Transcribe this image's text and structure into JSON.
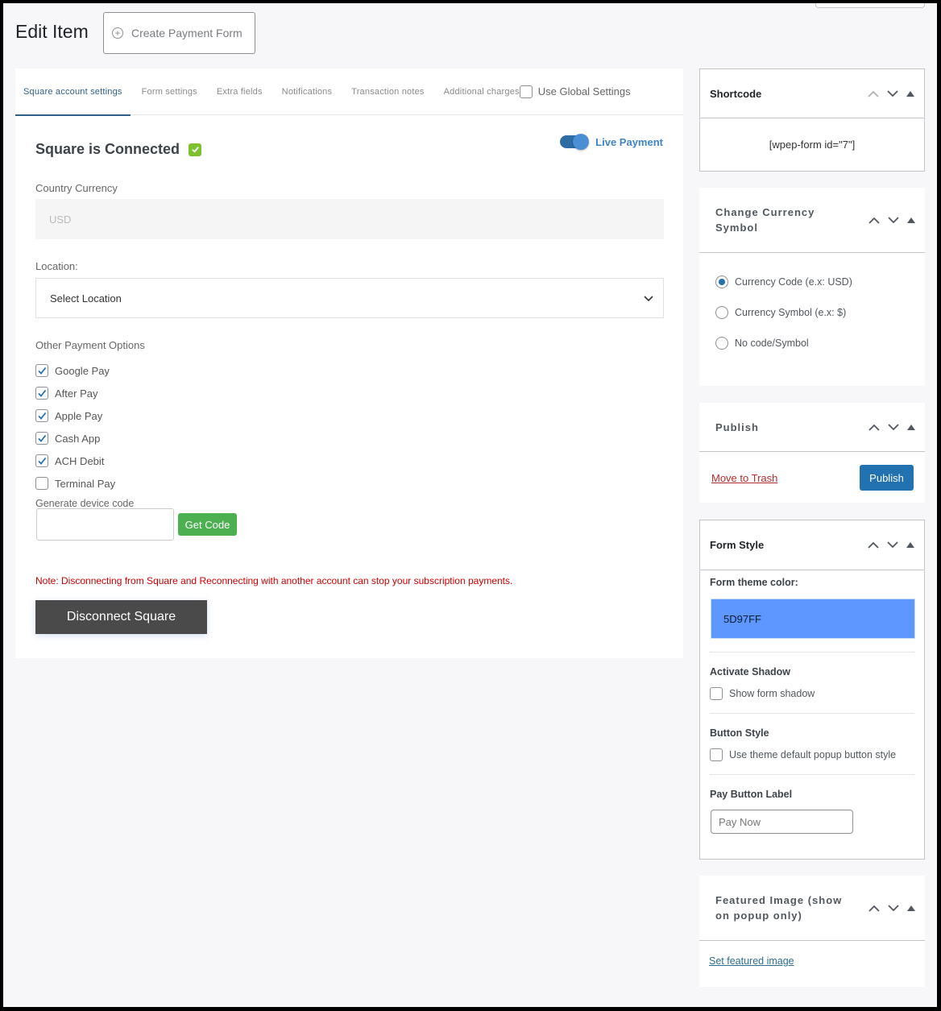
{
  "header": {
    "title": "Edit Item",
    "create_button": "Create Payment Form"
  },
  "tabs": [
    {
      "label": "Square account settings",
      "active": true
    },
    {
      "label": "Form settings",
      "active": false
    },
    {
      "label": "Extra fields",
      "active": false
    },
    {
      "label": "Notifications",
      "active": false
    },
    {
      "label": "Transaction notes",
      "active": false
    },
    {
      "label": "Additional charges",
      "active": false
    }
  ],
  "global_settings": {
    "label": "Use Global Settings",
    "checked": false
  },
  "square": {
    "status": "Square is Connected",
    "live_payment_label": "Live Payment",
    "live_payment_on": true,
    "currency_label": "Country Currency",
    "currency_value": "USD",
    "location_label": "Location:",
    "location_selected": "Select Location",
    "other_options_label": "Other Payment Options",
    "payment_options": [
      {
        "label": "Google Pay",
        "checked": true
      },
      {
        "label": "After Pay",
        "checked": true
      },
      {
        "label": "Apple Pay",
        "checked": true
      },
      {
        "label": "Cash App",
        "checked": true
      },
      {
        "label": "ACH Debit",
        "checked": true
      },
      {
        "label": "Terminal Pay",
        "checked": false
      }
    ],
    "device_code_label": "Generate device code",
    "device_code_value": "",
    "get_code_button": "Get Code",
    "note": "Note: Disconnecting from Square and Reconnecting with another account can stop your subscription payments.",
    "disconnect_button": "Disconnect Square"
  },
  "sidebar": {
    "shortcode": {
      "title": "Shortcode",
      "value": "[wpep-form id=\"7\"]"
    },
    "currency_symbol": {
      "title": "Change Currency Symbol",
      "options": [
        {
          "label": "Currency Code (e.x: USD)",
          "selected": true
        },
        {
          "label": "Currency Symbol (e.x: $)",
          "selected": false
        },
        {
          "label": "No code/Symbol",
          "selected": false
        }
      ]
    },
    "publish": {
      "title": "Publish",
      "trash_label": "Move to Trash",
      "publish_button": "Publish"
    },
    "form_style": {
      "title": "Form Style",
      "theme_color_label": "Form theme color:",
      "theme_color_value": "5D97FF",
      "theme_color_hex": "#5d97ff",
      "shadow_label": "Activate Shadow",
      "shadow_option": "Show form shadow",
      "shadow_checked": false,
      "button_style_label": "Button Style",
      "button_style_option": "Use theme default popup button style",
      "button_style_checked": false,
      "pay_label": "Pay Button Label",
      "pay_value": "Pay Now"
    },
    "featured_image": {
      "title": "Featured Image (show on popup only)",
      "link": "Set featured image"
    }
  },
  "colors": {
    "accent": "#2271b1",
    "tab_active": "#2e5f8a",
    "success": "#4caf50",
    "danger": "#cc0000",
    "dark_button": "#4a4a4a"
  }
}
